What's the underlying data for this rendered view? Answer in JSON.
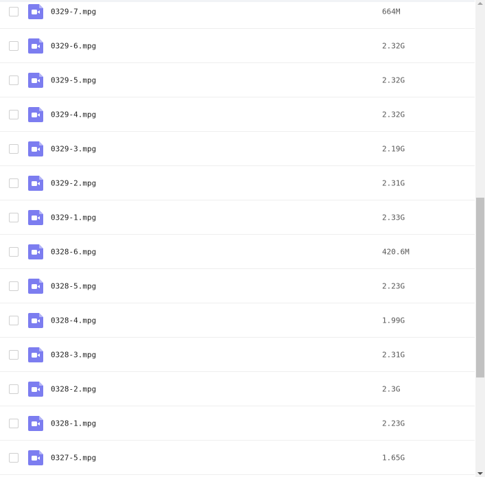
{
  "file_list": {
    "rows": [
      {
        "name": "0329-7.mpg",
        "size": "664M",
        "type_icon": "video-file-icon"
      },
      {
        "name": "0329-6.mpg",
        "size": "2.32G",
        "type_icon": "video-file-icon"
      },
      {
        "name": "0329-5.mpg",
        "size": "2.32G",
        "type_icon": "video-file-icon"
      },
      {
        "name": "0329-4.mpg",
        "size": "2.32G",
        "type_icon": "video-file-icon"
      },
      {
        "name": "0329-3.mpg",
        "size": "2.19G",
        "type_icon": "video-file-icon"
      },
      {
        "name": "0329-2.mpg",
        "size": "2.31G",
        "type_icon": "video-file-icon"
      },
      {
        "name": "0329-1.mpg",
        "size": "2.33G",
        "type_icon": "video-file-icon"
      },
      {
        "name": "0328-6.mpg",
        "size": "420.6M",
        "type_icon": "video-file-icon"
      },
      {
        "name": "0328-5.mpg",
        "size": "2.23G",
        "type_icon": "video-file-icon"
      },
      {
        "name": "0328-4.mpg",
        "size": "1.99G",
        "type_icon": "video-file-icon"
      },
      {
        "name": "0328-3.mpg",
        "size": "2.31G",
        "type_icon": "video-file-icon"
      },
      {
        "name": "0328-2.mpg",
        "size": "2.3G",
        "type_icon": "video-file-icon"
      },
      {
        "name": "0328-1.mpg",
        "size": "2.23G",
        "type_icon": "video-file-icon"
      },
      {
        "name": "0327-5.mpg",
        "size": "1.65G",
        "type_icon": "video-file-icon"
      }
    ]
  },
  "colors": {
    "icon_fill": "#7c7df0",
    "icon_fold": "#b3b4f7",
    "icon_glyph": "#ffffff",
    "row_divider": "#eeeeee",
    "scroll_thumb": "#c1c1c1"
  }
}
